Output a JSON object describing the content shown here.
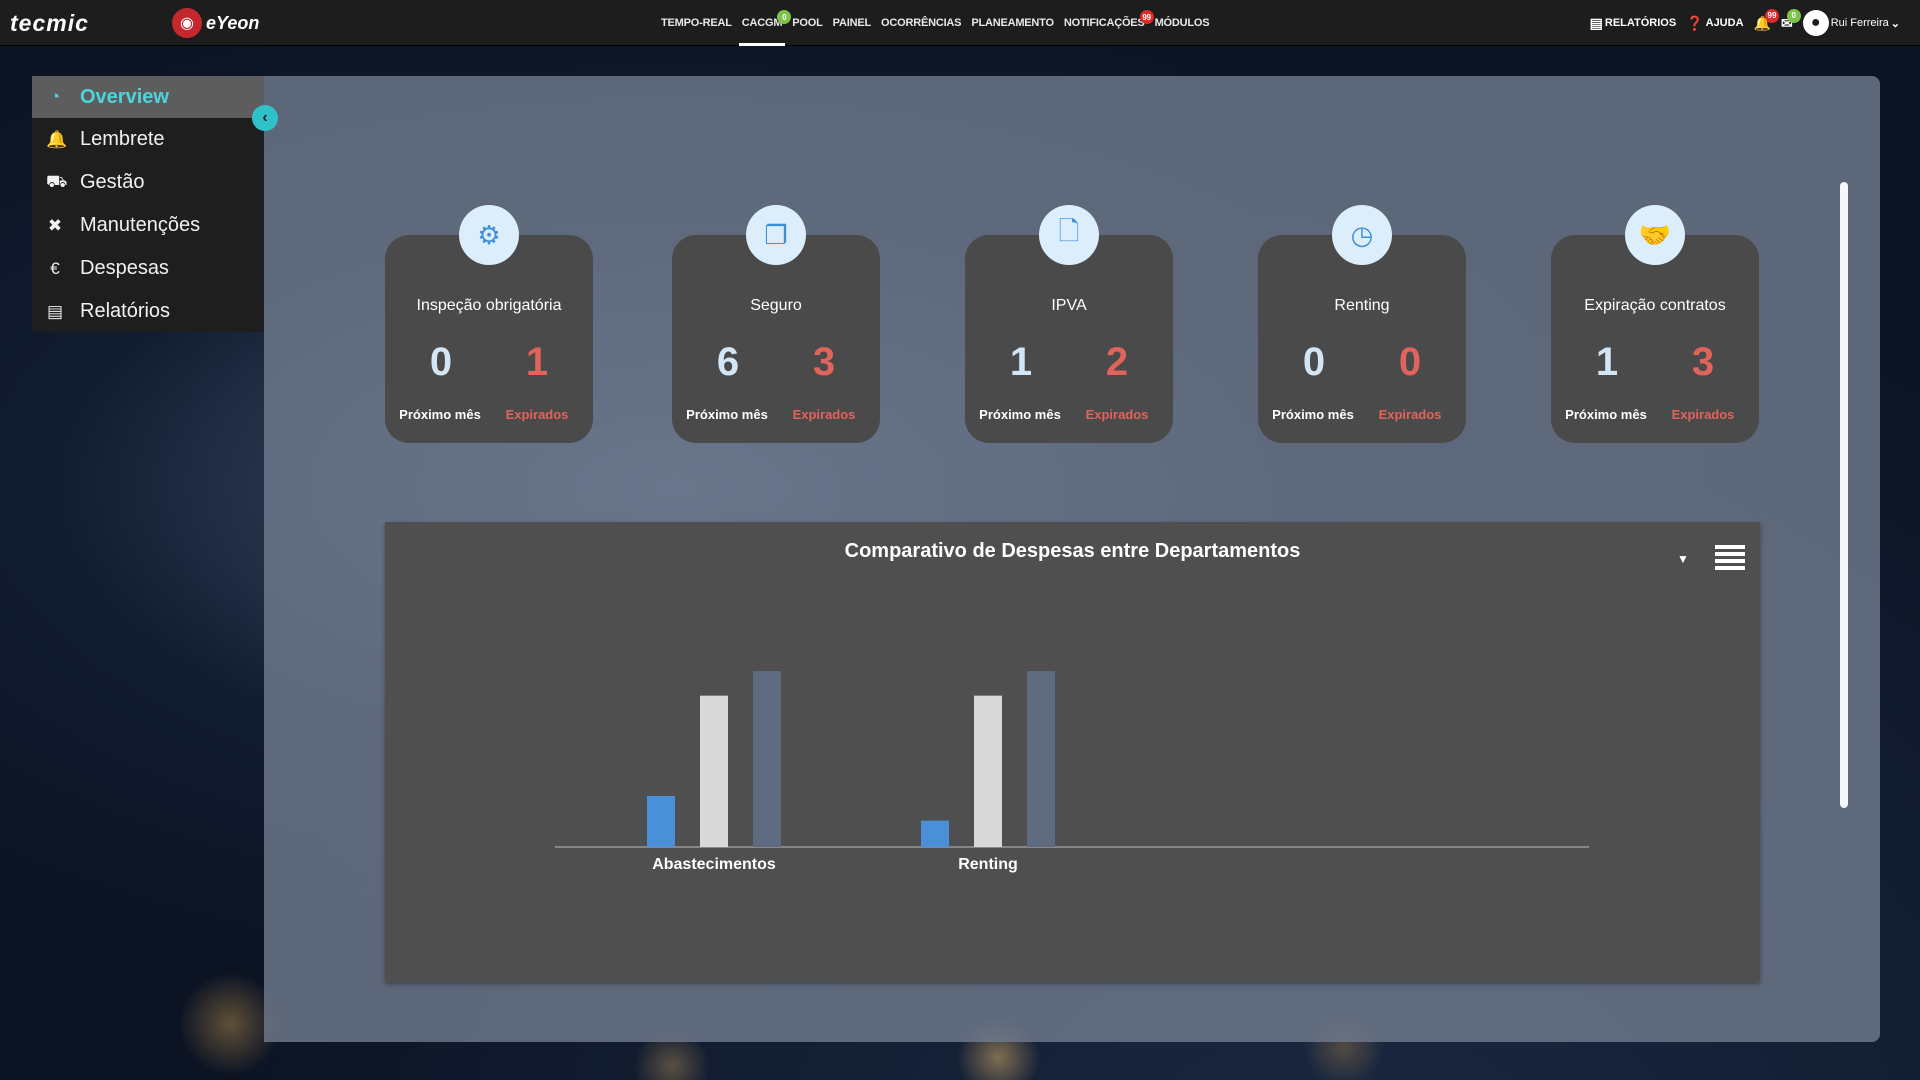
{
  "brand": {
    "logo_text": "tecmic",
    "partner_logo_text": "eYeon"
  },
  "nav": {
    "items": [
      {
        "label": "TEMPO-REAL",
        "badge": ""
      },
      {
        "label": "CACGM",
        "badge": "0",
        "badge_color": "green",
        "active": true
      },
      {
        "label": "POOL",
        "badge": ""
      },
      {
        "label": "PAINEL",
        "badge": ""
      },
      {
        "label": "OCORRÊNCIAS",
        "badge": ""
      },
      {
        "label": "PLANEAMENTO",
        "badge": ""
      },
      {
        "label": "NOTIFICAÇÕES",
        "badge": "99",
        "badge_color": "red"
      },
      {
        "label": "MÓDULOS",
        "badge": ""
      }
    ]
  },
  "tools": {
    "reports_label": "RELATÓRIOS",
    "help_label": "AJUDA",
    "bell_badge": "99",
    "mail_badge": "0",
    "username": "Rui Ferreira"
  },
  "sidebar": {
    "items": [
      {
        "label": "Overview",
        "icon": "pie-chart-icon",
        "glyph": "◔"
      },
      {
        "label": "Lembrete",
        "icon": "bell-icon",
        "glyph": "🔔"
      },
      {
        "label": "Gestão",
        "icon": "truck-icon",
        "glyph": "⛟"
      },
      {
        "label": "Manutenções",
        "icon": "tools-icon",
        "glyph": "✖"
      },
      {
        "label": "Despesas",
        "icon": "euro-icon",
        "glyph": "€"
      },
      {
        "label": "Relatórios",
        "icon": "report-file-icon",
        "glyph": "▤"
      }
    ]
  },
  "cards": [
    {
      "title": "Inspeção obrigatória",
      "icon": "gear-check-icon",
      "glyph": "⚙",
      "next_month": "0",
      "expired": "1"
    },
    {
      "title": "Seguro",
      "icon": "documents-icon",
      "glyph": "❐",
      "next_month": "6",
      "expired": "3"
    },
    {
      "title": "IPVA",
      "icon": "file-icon",
      "glyph": "🗋",
      "next_month": "1",
      "expired": "2"
    },
    {
      "title": "Renting",
      "icon": "gauge-icon",
      "glyph": "◷",
      "next_month": "0",
      "expired": "0"
    },
    {
      "title": "Expiração contratos",
      "icon": "handshake-icon",
      "glyph": "🤝",
      "next_month": "1",
      "expired": "3"
    }
  ],
  "card_labels": {
    "next_month": "Próximo mês",
    "expired": "Expirados"
  },
  "colors": {
    "accent": "#2fc1c9",
    "expired": "#e0645b",
    "series_1": "#4a90d9",
    "series_2": "#d9d9d9",
    "series_3": "#5e6a80"
  },
  "chart_data": {
    "type": "bar",
    "title": "Comparativo de Despesas entre Departamentos",
    "categories": [
      "Abastecimentos",
      "Renting"
    ],
    "series": [
      {
        "values": [
          29,
          15
        ]
      },
      {
        "values": [
          86,
          86
        ]
      },
      {
        "values": [
          100,
          100
        ]
      }
    ],
    "ylim": [
      0,
      100
    ],
    "grid": false,
    "legend": "none"
  }
}
